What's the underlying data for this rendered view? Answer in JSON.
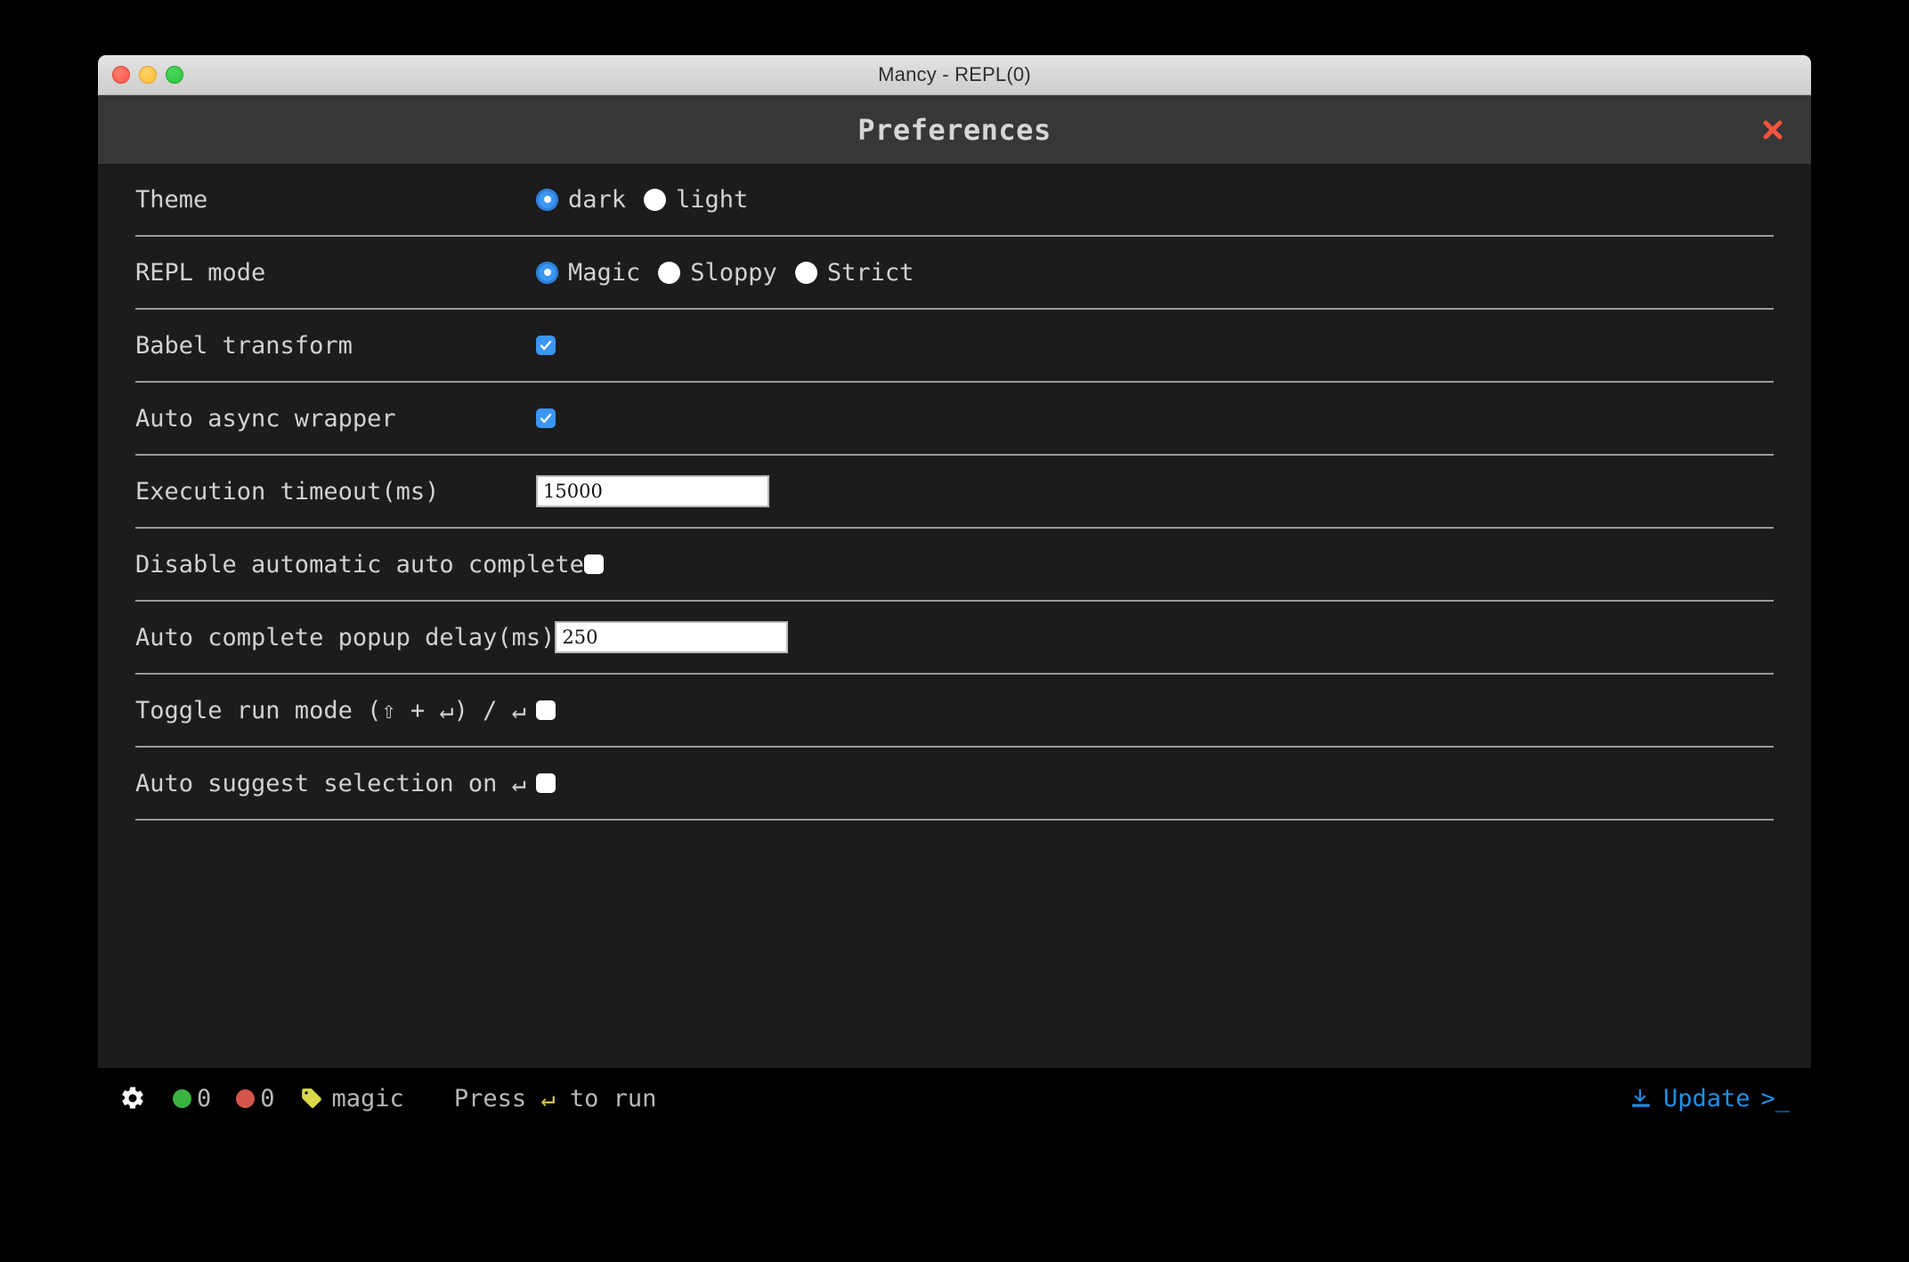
{
  "window": {
    "os_title": "Mancy - REPL(0)",
    "traffic_lights": [
      "close",
      "minimize",
      "zoom"
    ]
  },
  "prefs": {
    "header_title": "Preferences",
    "close_label": "✖",
    "rows": [
      {
        "label": "Theme",
        "type": "radio",
        "options": [
          {
            "label": "dark",
            "selected": true
          },
          {
            "label": "light",
            "selected": false
          }
        ]
      },
      {
        "label": "REPL mode",
        "type": "radio",
        "options": [
          {
            "label": "Magic",
            "selected": true
          },
          {
            "label": "Sloppy",
            "selected": false
          },
          {
            "label": "Strict",
            "selected": false
          }
        ]
      },
      {
        "label": "Babel transform",
        "type": "checkbox",
        "checked": true
      },
      {
        "label": "Auto async wrapper",
        "type": "checkbox",
        "checked": true
      },
      {
        "label": "Execution timeout(ms)",
        "type": "input",
        "value": "15000",
        "placeholder": ""
      },
      {
        "label": "Disable automatic auto complete",
        "type": "checkbox",
        "checked": false
      },
      {
        "label": "Auto complete popup delay(ms)",
        "type": "input",
        "value": "250",
        "placeholder": ""
      },
      {
        "label": "Toggle run mode (⇧ + ↵) / ↵",
        "type": "checkbox",
        "checked": false
      },
      {
        "label": "Auto suggest selection on ↵",
        "type": "checkbox",
        "checked": false
      }
    ]
  },
  "statusbar": {
    "gear_icon": "gear-icon",
    "success_count": "0",
    "error_count": "0",
    "tag_icon": "tag-icon",
    "mode_label": "magic",
    "hint_prefix": "Press ",
    "hint_key": "↵",
    "hint_suffix": " to run",
    "update_label": "Update",
    "prompt_label": ">_"
  },
  "colors": {
    "accent_blue": "#3b96f4",
    "link_blue": "#1e8fe8",
    "close_red": "#f4543f",
    "success_green": "#3bb344",
    "error_red": "#d4564a",
    "tag_yellow": "#d8d84a",
    "window_bg": "#1c1c1c",
    "header_bg": "#373737"
  }
}
